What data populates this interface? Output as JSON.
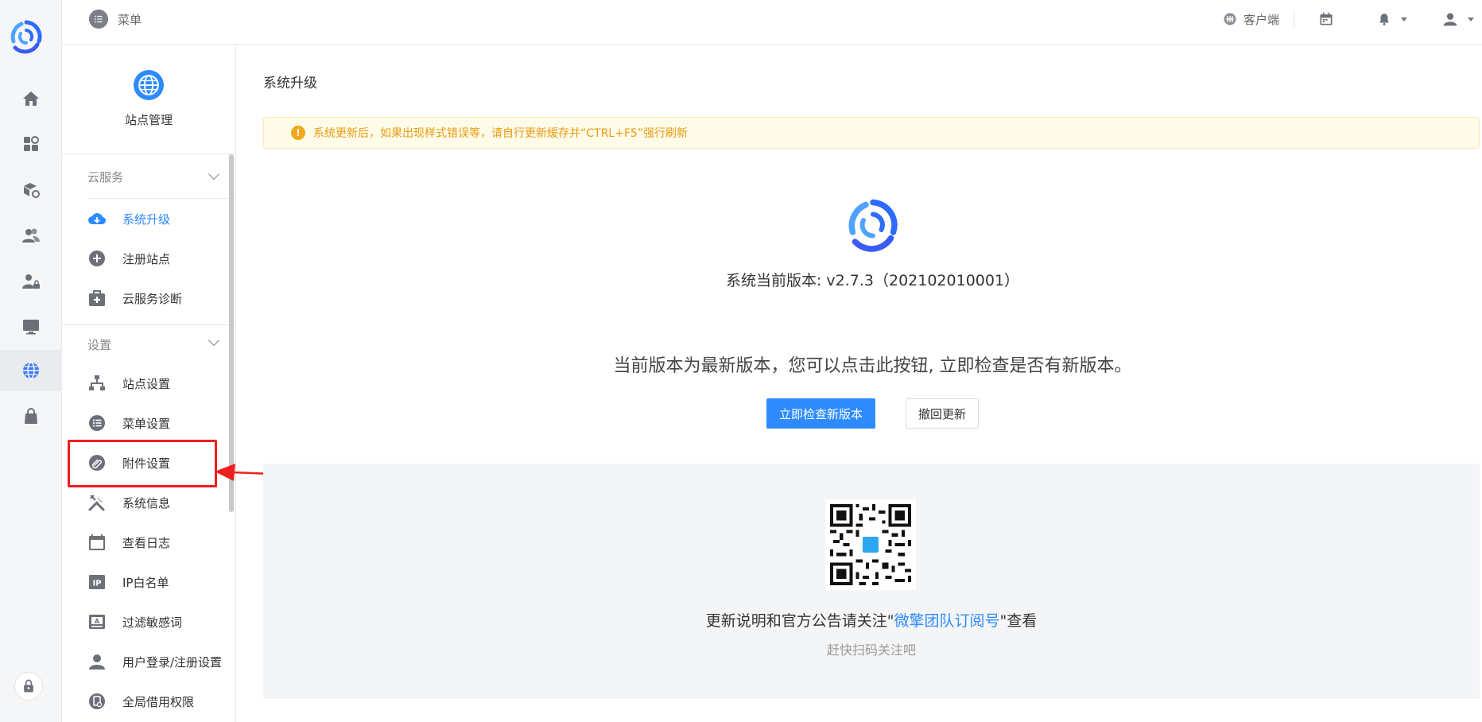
{
  "topbar": {
    "menu_label": "菜单",
    "client_label": "客户端"
  },
  "sidebar": {
    "header_title": "站点管理",
    "groups": [
      {
        "title": "云服务",
        "items": [
          {
            "label": "系统升级",
            "icon": "cloud-download-icon"
          },
          {
            "label": "注册站点",
            "icon": "plus-circle-icon"
          },
          {
            "label": "云服务诊断",
            "icon": "medical-kit-icon"
          }
        ]
      },
      {
        "title": "设置",
        "items": [
          {
            "label": "站点设置",
            "icon": "sitemap-icon"
          },
          {
            "label": "菜单设置",
            "icon": "list-icon"
          },
          {
            "label": "附件设置",
            "icon": "paperclip-icon"
          },
          {
            "label": "系统信息",
            "icon": "wrench-icon"
          },
          {
            "label": "查看日志",
            "icon": "calendar-icon"
          },
          {
            "label": "IP白名单",
            "icon": "ip-icon"
          },
          {
            "label": "过滤敏感词",
            "icon": "filter-text-icon"
          },
          {
            "label": "用户登录/注册设置",
            "icon": "user-icon"
          },
          {
            "label": "全局借用权限",
            "icon": "permission-icon"
          }
        ]
      }
    ]
  },
  "main": {
    "page_title": "系统升级",
    "notice": "系统更新后，如果出现样式错误等，请自行更新缓存并“CTRL+F5”强行刷新",
    "version_text": "系统当前版本: v2.7.3（202102010001）",
    "latest_text": "当前版本为最新版本，您可以点击此按钮, 立即检查是否有新版本。",
    "check_button": "立即检查新版本",
    "rollback_button": "撤回更新",
    "promo_prefix": "更新说明和官方公告请关注\"",
    "promo_link": "微擎团队订阅号",
    "promo_suffix": "\"查看",
    "promo_sub": "赶快扫码关注吧"
  },
  "colors": {
    "accent": "#2e8bff",
    "warning": "#e89b12",
    "highlight": "#ee1f1f"
  }
}
